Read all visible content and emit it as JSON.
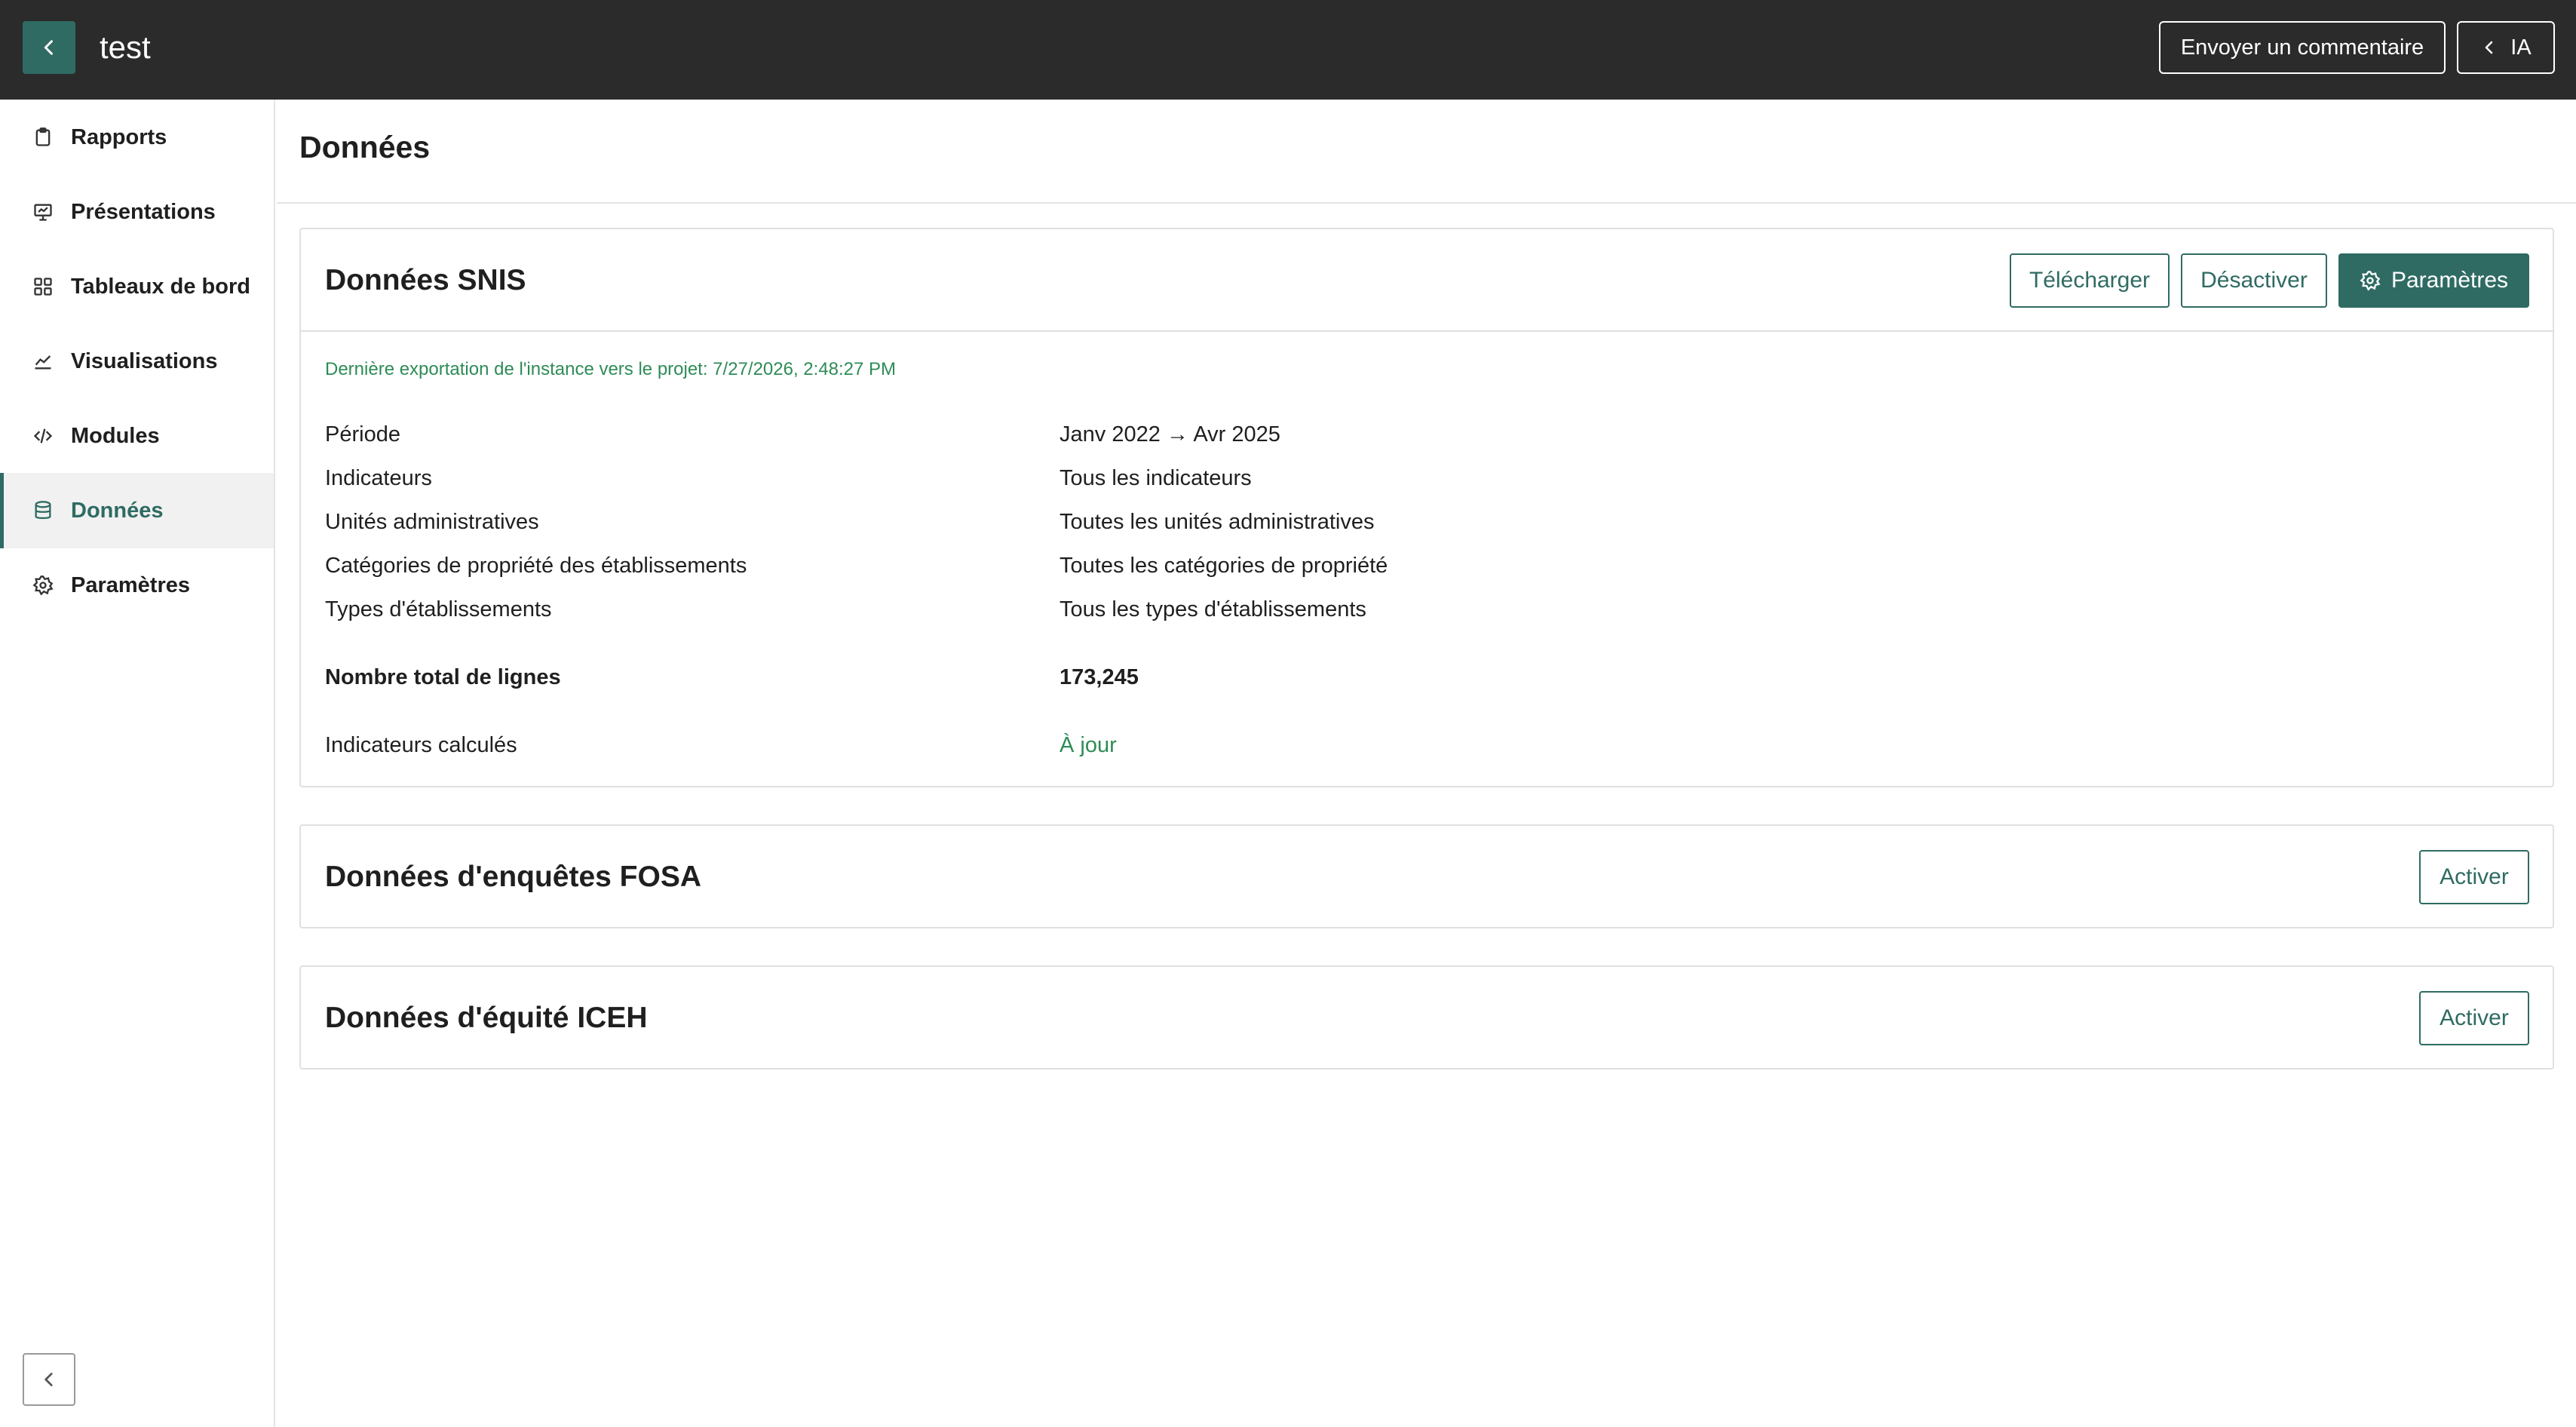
{
  "header": {
    "title": "test",
    "feedback_label": "Envoyer un commentaire",
    "ai_label": "IA"
  },
  "sidebar": {
    "items": [
      {
        "label": "Rapports",
        "icon": "clipboard-icon"
      },
      {
        "label": "Présentations",
        "icon": "presentation-icon"
      },
      {
        "label": "Tableaux de bord",
        "icon": "dashboard-icon"
      },
      {
        "label": "Visualisations",
        "icon": "chart-line-icon"
      },
      {
        "label": "Modules",
        "icon": "code-icon"
      },
      {
        "label": "Données",
        "icon": "database-icon",
        "active": true
      },
      {
        "label": "Paramètres",
        "icon": "gear-icon"
      }
    ]
  },
  "main": {
    "title": "Données",
    "snis": {
      "title": "Données SNIS",
      "download_label": "Télécharger",
      "deactivate_label": "Désactiver",
      "settings_label": "Paramètres",
      "export_note": "Dernière exportation de l'instance vers le projet: 7/27/2026, 2:48:27 PM",
      "rows": [
        {
          "label": "Période",
          "value": "Janv 2022 → Avr 2025"
        },
        {
          "label": "Indicateurs",
          "value": "Tous les indicateurs"
        },
        {
          "label": "Unités administratives",
          "value": "Toutes les unités administratives"
        },
        {
          "label": "Catégories de propriété des établissements",
          "value": "Toutes les catégories de propriété"
        },
        {
          "label": "Types d'établissements",
          "value": "Tous les types d'établissements"
        }
      ],
      "total_label": "Nombre total de lignes",
      "total_value": "173,245",
      "calc_label": "Indicateurs calculés",
      "calc_value": "À jour"
    },
    "fosa": {
      "title": "Données d'enquêtes FOSA",
      "activate_label": "Activer"
    },
    "iceh": {
      "title": "Données d'équité ICEH",
      "activate_label": "Activer"
    }
  },
  "colors": {
    "accent": "#2f6b63",
    "topbar": "#2b2b2b",
    "status_green": "#2e8b57"
  }
}
